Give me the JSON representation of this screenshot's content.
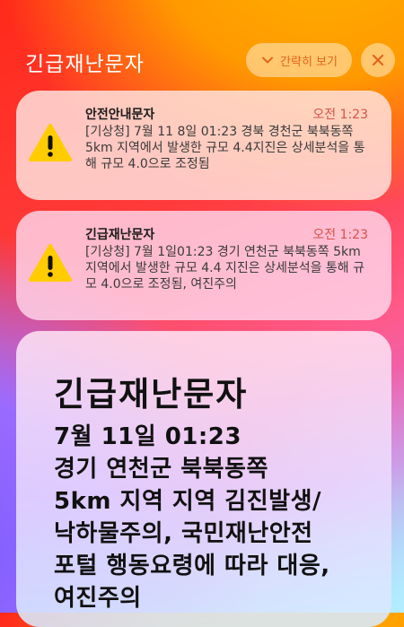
{
  "header": {
    "title": "긴급재난문자",
    "collapse_label": "간략히 보기"
  },
  "notifications": [
    {
      "sender": "안전안내문자",
      "time": "오전 1:23",
      "body": "[기상청] 7월 11 8일 01:23 경북 경천군 북북동쪽 5km 지역에서 발생한 규모 4.4지진은 상세분석을 통해 규모 4.0으로 조정됨",
      "icon": "warning-icon"
    },
    {
      "sender": "긴급재난문자",
      "time": "오전 1:23",
      "body": "[기상청] 7월 1일01:23  경기 연천군 북북동쪽 5km 지역에서 발생한 규모 4.4 지진은 상세분석을 통해 규모 4.0으로 조정됨, 여진주의",
      "icon": "warning-icon"
    }
  ],
  "expanded": {
    "title": "긴급재난문자",
    "body": "7월 11일 01:23\n경기 연천군 북북동쪽\n5km 지역 지역 김진발생/\n낙하물주의, 국민재난안전\n포털 행동요령에 따라 대응,\n여진주의"
  },
  "colors": {
    "accent": "#e0651b",
    "time": "#d4534a",
    "warning_fill": "#ffcc00"
  }
}
